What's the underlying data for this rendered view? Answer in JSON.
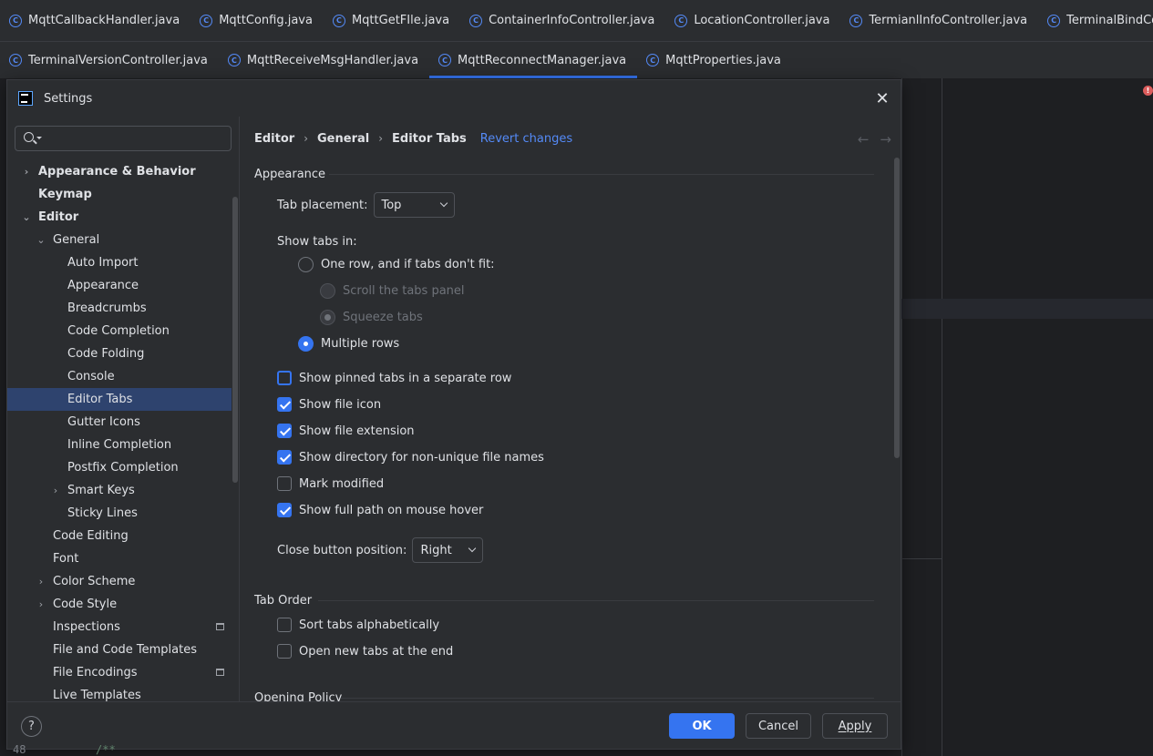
{
  "editor_tabs": {
    "row1": [
      "MqttCallbackHandler.java",
      "MqttConfig.java",
      "MqttGetFIle.java",
      "ContainerInfoController.java",
      "LocationController.java",
      "TermianlInfoController.java",
      "TerminalBindController.java"
    ],
    "row2": [
      "TerminalVersionController.java",
      "MqttReceiveMsgHandler.java",
      "MqttReconnectManager.java",
      "MqttProperties.java"
    ],
    "active": "MqttReconnectManager.java",
    "class_icon_glyph": "C"
  },
  "dialog": {
    "title": "Settings",
    "close_glyph": "✕"
  },
  "tree": {
    "items": [
      {
        "label": "Appearance & Behavior",
        "level": 0,
        "bold": true,
        "arrow": "›"
      },
      {
        "label": "Keymap",
        "level": 0,
        "bold": true,
        "arrow": ""
      },
      {
        "label": "Editor",
        "level": 0,
        "bold": true,
        "arrow": "⌄"
      },
      {
        "label": "General",
        "level": 1,
        "bold": false,
        "arrow": "⌄"
      },
      {
        "label": "Auto Import",
        "level": 2,
        "bold": false,
        "arrow": ""
      },
      {
        "label": "Appearance",
        "level": 2,
        "bold": false,
        "arrow": ""
      },
      {
        "label": "Breadcrumbs",
        "level": 2,
        "bold": false,
        "arrow": ""
      },
      {
        "label": "Code Completion",
        "level": 2,
        "bold": false,
        "arrow": ""
      },
      {
        "label": "Code Folding",
        "level": 2,
        "bold": false,
        "arrow": ""
      },
      {
        "label": "Console",
        "level": 2,
        "bold": false,
        "arrow": ""
      },
      {
        "label": "Editor Tabs",
        "level": 2,
        "bold": false,
        "arrow": "",
        "selected": true
      },
      {
        "label": "Gutter Icons",
        "level": 2,
        "bold": false,
        "arrow": ""
      },
      {
        "label": "Inline Completion",
        "level": 2,
        "bold": false,
        "arrow": ""
      },
      {
        "label": "Postfix Completion",
        "level": 2,
        "bold": false,
        "arrow": ""
      },
      {
        "label": "Smart Keys",
        "level": 2,
        "bold": false,
        "arrow": "›"
      },
      {
        "label": "Sticky Lines",
        "level": 2,
        "bold": false,
        "arrow": ""
      },
      {
        "label": "Code Editing",
        "level": 1,
        "bold": false,
        "arrow": ""
      },
      {
        "label": "Font",
        "level": 1,
        "bold": false,
        "arrow": ""
      },
      {
        "label": "Color Scheme",
        "level": 1,
        "bold": false,
        "arrow": "›"
      },
      {
        "label": "Code Style",
        "level": 1,
        "bold": false,
        "arrow": "›"
      },
      {
        "label": "Inspections",
        "level": 1,
        "bold": false,
        "arrow": "",
        "project_mark": true
      },
      {
        "label": "File and Code Templates",
        "level": 1,
        "bold": false,
        "arrow": ""
      },
      {
        "label": "File Encodings",
        "level": 1,
        "bold": false,
        "arrow": "",
        "project_mark": true
      },
      {
        "label": "Live Templates",
        "level": 1,
        "bold": false,
        "arrow": ""
      }
    ]
  },
  "breadcrumb": {
    "items": [
      "Editor",
      "General",
      "Editor Tabs"
    ],
    "separator": "›",
    "revert": "Revert changes",
    "back_glyph": "←",
    "forward_glyph": "→"
  },
  "appearance": {
    "title": "Appearance",
    "tab_placement_label": "Tab placement:",
    "tab_placement_value": "Top",
    "show_tabs_in_label": "Show tabs in:",
    "radio_one_row": "One row, and if tabs don't fit:",
    "radio_scroll": "Scroll the tabs panel",
    "radio_squeeze": "Squeeze tabs",
    "radio_multiple": "Multiple rows",
    "checks": [
      {
        "label": "Show pinned tabs in a separate row",
        "checked": false,
        "focused": true
      },
      {
        "label": "Show file icon",
        "checked": true
      },
      {
        "label": "Show file extension",
        "checked": true
      },
      {
        "label": "Show directory for non-unique file names",
        "checked": true
      },
      {
        "label": "Mark modified",
        "checked": false
      },
      {
        "label": "Show full path on mouse hover",
        "checked": true
      }
    ],
    "close_button_label": "Close button position:",
    "close_button_value": "Right"
  },
  "tab_order": {
    "title": "Tab Order",
    "checks": [
      {
        "label": "Sort tabs alphabetically",
        "checked": false
      },
      {
        "label": "Open new tabs at the end",
        "checked": false
      }
    ]
  },
  "opening_policy": {
    "title": "Opening Policy"
  },
  "footer": {
    "help": "?",
    "ok": "OK",
    "cancel": "Cancel",
    "apply": "Apply"
  },
  "background": {
    "line_number": "48",
    "code_fragment": "/**",
    "error_glyph": "!"
  },
  "colors": {
    "accent": "#3574f0",
    "link": "#548af7",
    "selection": "#2e436e",
    "dialog_bg": "#2b2d30"
  }
}
